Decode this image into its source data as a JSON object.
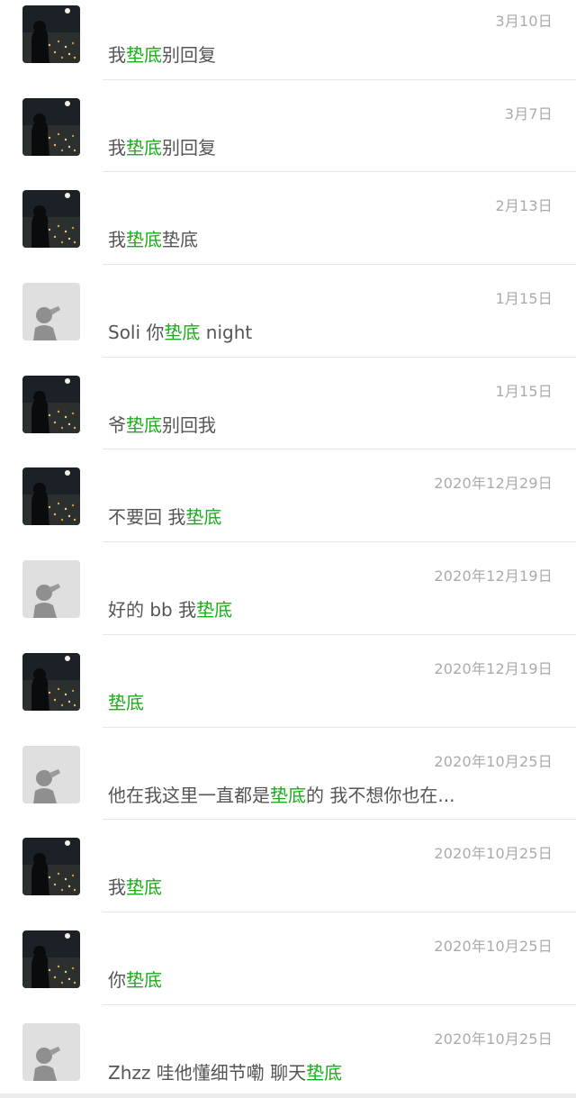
{
  "highlight_color": "#1aad19",
  "results": [
    {
      "avatar": "night-city-icon",
      "date": "3月10日",
      "pre": "我",
      "kw": "垫底",
      "post": "别回复"
    },
    {
      "avatar": "night-city-icon",
      "date": "3月7日",
      "pre": "我",
      "kw": "垫底",
      "post": "别回复"
    },
    {
      "avatar": "night-city-icon",
      "date": "2月13日",
      "pre": "我",
      "kw": "垫底",
      "post": "垫底"
    },
    {
      "avatar": "shadow-silhouette-icon",
      "date": "1月15日",
      "pre": "Soli 你",
      "kw": "垫底",
      "post": " night"
    },
    {
      "avatar": "night-city-icon",
      "date": "1月15日",
      "pre": "爷",
      "kw": "垫底",
      "post": "别回我"
    },
    {
      "avatar": "night-city-icon",
      "date": "2020年12月29日",
      "pre": "不要回 我",
      "kw": "垫底",
      "post": ""
    },
    {
      "avatar": "shadow-silhouette-icon",
      "date": "2020年12月19日",
      "pre": "好的 bb 我",
      "kw": "垫底",
      "post": ""
    },
    {
      "avatar": "night-city-icon",
      "date": "2020年12月19日",
      "pre": "",
      "kw": "垫底",
      "post": ""
    },
    {
      "avatar": "shadow-silhouette-icon",
      "date": "2020年10月25日",
      "pre": "他在我这里一直都是",
      "kw": "垫底",
      "post": "的 我不想你也在..."
    },
    {
      "avatar": "night-city-icon",
      "date": "2020年10月25日",
      "pre": "我",
      "kw": "垫底",
      "post": ""
    },
    {
      "avatar": "night-city-icon",
      "date": "2020年10月25日",
      "pre": "你",
      "kw": "垫底",
      "post": ""
    },
    {
      "avatar": "shadow-silhouette-icon",
      "date": "2020年10月25日",
      "pre": "Zhzz 哇他懂细节嘞 聊天",
      "kw": "垫底",
      "post": ""
    }
  ]
}
